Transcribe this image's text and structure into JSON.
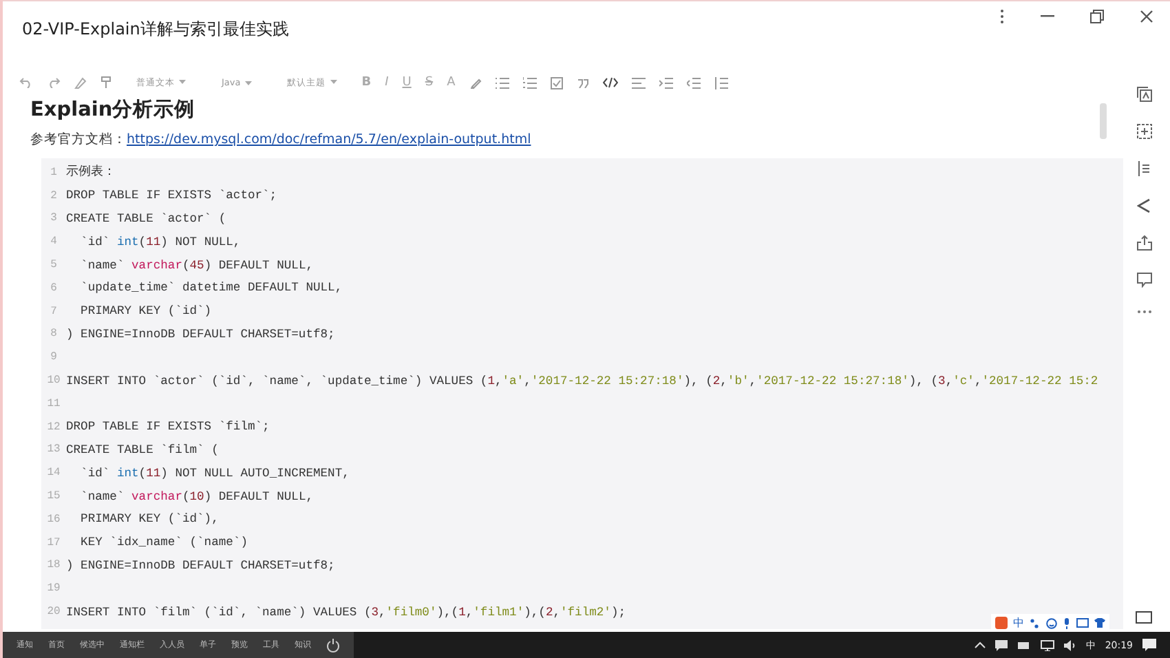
{
  "window": {
    "title": "02-VIP-Explain详解与索引最佳实践"
  },
  "toolbar": {
    "dropdowns": [
      "普通文本",
      "Java",
      "默认主题"
    ],
    "format_letters": [
      "B",
      "I",
      "U",
      "S"
    ],
    "color_letter": "A"
  },
  "document": {
    "heading": "Explain分析示例",
    "reference_label": "参考官方文档：",
    "reference_link": "https://dev.mysql.com/doc/refman/5.7/en/explain-output.html"
  },
  "code": {
    "lines": [
      {
        "number": "1",
        "tokens": [
          {
            "text": "示例表：",
            "kind": "plain"
          }
        ]
      },
      {
        "number": "2",
        "tokens": [
          {
            "text": "DROP TABLE IF EXISTS `actor`;",
            "kind": "plain"
          }
        ]
      },
      {
        "number": "3",
        "tokens": [
          {
            "text": "CREATE TABLE `actor` (",
            "kind": "plain"
          }
        ]
      },
      {
        "number": "4",
        "tokens": [
          {
            "text": "  `id` ",
            "kind": "plain"
          },
          {
            "text": "int",
            "kind": "type"
          },
          {
            "text": "(",
            "kind": "plain"
          },
          {
            "text": "11",
            "kind": "num"
          },
          {
            "text": ") NOT NULL,",
            "kind": "plain"
          }
        ]
      },
      {
        "number": "5",
        "tokens": [
          {
            "text": "  `name` ",
            "kind": "plain"
          },
          {
            "text": "varchar",
            "kind": "func"
          },
          {
            "text": "(",
            "kind": "plain"
          },
          {
            "text": "45",
            "kind": "num"
          },
          {
            "text": ") DEFAULT NULL,",
            "kind": "plain"
          }
        ]
      },
      {
        "number": "6",
        "tokens": [
          {
            "text": "  `update_time` datetime DEFAULT NULL,",
            "kind": "plain"
          }
        ]
      },
      {
        "number": "7",
        "tokens": [
          {
            "text": "  PRIMARY KEY (`id`)",
            "kind": "plain"
          }
        ]
      },
      {
        "number": "8",
        "tokens": [
          {
            "text": ") ENGINE=InnoDB DEFAULT CHARSET=utf8;",
            "kind": "plain"
          }
        ]
      },
      {
        "number": "9"
      },
      {
        "number": "10",
        "tokens": [
          {
            "text": "INSERT INTO `actor` (`id`, `name`, `update_time`) VALUES (",
            "kind": "plain"
          },
          {
            "text": "1",
            "kind": "num"
          },
          {
            "text": ",",
            "kind": "plain"
          },
          {
            "text": "'a'",
            "kind": "str"
          },
          {
            "text": ",",
            "kind": "plain"
          },
          {
            "text": "'2017-12-22 15:27:18'",
            "kind": "str"
          },
          {
            "text": "), (",
            "kind": "plain"
          },
          {
            "text": "2",
            "kind": "num"
          },
          {
            "text": ",",
            "kind": "plain"
          },
          {
            "text": "'b'",
            "kind": "str"
          },
          {
            "text": ",",
            "kind": "plain"
          },
          {
            "text": "'2017-12-22 15:27:18'",
            "kind": "str"
          },
          {
            "text": "), (",
            "kind": "plain"
          },
          {
            "text": "3",
            "kind": "num"
          },
          {
            "text": ",",
            "kind": "plain"
          },
          {
            "text": "'c'",
            "kind": "str"
          },
          {
            "text": ",",
            "kind": "plain"
          },
          {
            "text": "'2017-12-22 15:2",
            "kind": "str"
          }
        ]
      },
      {
        "number": "11"
      },
      {
        "number": "12",
        "tokens": [
          {
            "text": "DROP TABLE IF EXISTS `film`;",
            "kind": "plain"
          }
        ]
      },
      {
        "number": "13",
        "tokens": [
          {
            "text": "CREATE TABLE `film` (",
            "kind": "plain"
          }
        ]
      },
      {
        "number": "14",
        "tokens": [
          {
            "text": "  `id` ",
            "kind": "plain"
          },
          {
            "text": "int",
            "kind": "type"
          },
          {
            "text": "(",
            "kind": "plain"
          },
          {
            "text": "11",
            "kind": "num"
          },
          {
            "text": ") NOT NULL AUTO_INCREMENT,",
            "kind": "plain"
          }
        ]
      },
      {
        "number": "15",
        "tokens": [
          {
            "text": "  `name` ",
            "kind": "plain"
          },
          {
            "text": "varchar",
            "kind": "func"
          },
          {
            "text": "(",
            "kind": "plain"
          },
          {
            "text": "10",
            "kind": "num"
          },
          {
            "text": ") DEFAULT NULL,",
            "kind": "plain"
          }
        ]
      },
      {
        "number": "16",
        "tokens": [
          {
            "text": "  PRIMARY KEY (`id`),",
            "kind": "plain"
          }
        ]
      },
      {
        "number": "17",
        "tokens": [
          {
            "text": "  KEY `idx_name` (`name`)",
            "kind": "plain"
          }
        ]
      },
      {
        "number": "18",
        "tokens": [
          {
            "text": ") ENGINE=InnoDB DEFAULT CHARSET=utf8;",
            "kind": "plain"
          }
        ]
      },
      {
        "number": "19"
      },
      {
        "number": "20",
        "tokens": [
          {
            "text": "INSERT INTO `film` (`id`, `name`) VALUES (",
            "kind": "plain"
          },
          {
            "text": "3",
            "kind": "num"
          },
          {
            "text": ",",
            "kind": "plain"
          },
          {
            "text": "'film0'",
            "kind": "str"
          },
          {
            "text": "),(",
            "kind": "plain"
          },
          {
            "text": "1",
            "kind": "num"
          },
          {
            "text": ",",
            "kind": "plain"
          },
          {
            "text": "'film1'",
            "kind": "str"
          },
          {
            "text": "),(",
            "kind": "plain"
          },
          {
            "text": "2",
            "kind": "num"
          },
          {
            "text": ",",
            "kind": "plain"
          },
          {
            "text": "'film2'",
            "kind": "str"
          },
          {
            "text": ");",
            "kind": "plain"
          }
        ]
      }
    ]
  },
  "ime_bar": {
    "mode": "中"
  },
  "taskbar": {
    "items": [
      "通知",
      "首页",
      "候选中",
      "通知栏",
      "入人员",
      "单子",
      "预览",
      "工具",
      "知识"
    ],
    "input_mode": "中",
    "time": "20:19"
  }
}
